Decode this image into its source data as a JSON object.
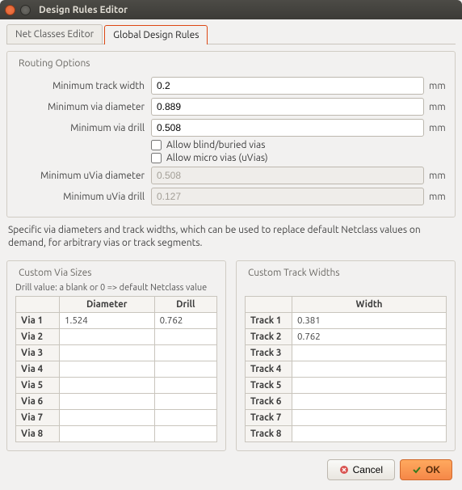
{
  "window": {
    "title": "Design Rules Editor"
  },
  "tabs": {
    "netclass": "Net Classes Editor",
    "global": "Global Design Rules"
  },
  "routing": {
    "title": "Routing Options",
    "min_track_width": {
      "label": "Minimum track width",
      "value": "0.2",
      "unit": "mm"
    },
    "min_via_diam": {
      "label": "Minimum via diameter",
      "value": "0.889",
      "unit": "mm"
    },
    "min_via_drill": {
      "label": "Minimum via drill",
      "value": "0.508",
      "unit": "mm"
    },
    "allow_blind": {
      "label": "Allow blind/buried vias"
    },
    "allow_micro": {
      "label": "Allow micro vias (uVias)"
    },
    "min_uvia_diam": {
      "label": "Minimum uVia diameter",
      "value": "0.508",
      "unit": "mm"
    },
    "min_uvia_drill": {
      "label": "Minimum uVia drill",
      "value": "0.127",
      "unit": "mm"
    }
  },
  "hint": "Specific via diameters and track widths, which can be used to replace default Netclass values on demand, for arbitrary vias or track segments.",
  "custom_via": {
    "title": "Custom Via Sizes",
    "drill_hint": "Drill value: a blank or 0 => default Netclass value",
    "headers": {
      "diameter": "Diameter",
      "drill": "Drill"
    },
    "rows": [
      {
        "label": "Via 1",
        "diameter": "1.524",
        "drill": "0.762"
      },
      {
        "label": "Via 2",
        "diameter": "",
        "drill": ""
      },
      {
        "label": "Via 3",
        "diameter": "",
        "drill": ""
      },
      {
        "label": "Via 4",
        "diameter": "",
        "drill": ""
      },
      {
        "label": "Via 5",
        "diameter": "",
        "drill": ""
      },
      {
        "label": "Via 6",
        "diameter": "",
        "drill": ""
      },
      {
        "label": "Via 7",
        "diameter": "",
        "drill": ""
      },
      {
        "label": "Via 8",
        "diameter": "",
        "drill": ""
      }
    ]
  },
  "custom_track": {
    "title": "Custom Track Widths",
    "headers": {
      "width": "Width"
    },
    "rows": [
      {
        "label": "Track 1",
        "width": "0.381"
      },
      {
        "label": "Track 2",
        "width": "0.762"
      },
      {
        "label": "Track 3",
        "width": ""
      },
      {
        "label": "Track 4",
        "width": ""
      },
      {
        "label": "Track 5",
        "width": ""
      },
      {
        "label": "Track 6",
        "width": ""
      },
      {
        "label": "Track 7",
        "width": ""
      },
      {
        "label": "Track 8",
        "width": ""
      }
    ]
  },
  "buttons": {
    "cancel": "Cancel",
    "ok": "OK"
  }
}
